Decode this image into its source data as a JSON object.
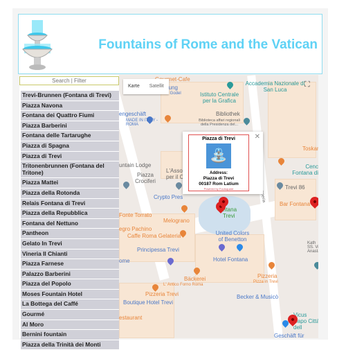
{
  "header": {
    "title": "Fountains of Rome and the Vatican"
  },
  "sidebar": {
    "search_placeholder": "Search | Filter",
    "items": [
      "Trevi-Brunnen (Fontana di Trevi)",
      "Piazza Navona",
      "Fontana dei Quattro Fiumi",
      "Piazza Barberini",
      "Fontana delle Tartarughe",
      "Piazza di Spagna",
      "Piazza di Trevi",
      "Tritonenbrunnen (Fontana del Tritone)",
      "Piazza Mattei",
      "Piazza della Rotonda",
      "Relais Fontana di Trevi",
      "Piazza della Repubblica",
      "Fontana del Nettuno",
      "Pantheon",
      "Gelato In Trevi",
      "Vineria Il Chianti",
      "Piazza Farnese",
      "Palazzo Barberini",
      "Piazza del Popolo",
      "Moses Fountain Hotel",
      "La Bottega del Caffé",
      "Gourmé",
      "Al Moro",
      "Bernini fountain",
      "Piazza della Trinità dei Monti"
    ]
  },
  "map": {
    "map_type": [
      "Karte",
      "Satellit"
    ],
    "fullscreen_icon": "fullscreen-icon",
    "labels": {
      "gourmet": "Gourmet-Cafe",
      "handlung": "handlung",
      "godel": "Libreria Godel",
      "istituto": "Istituto Centrale per la Grafica",
      "accademia": "Accademia Nazionale di San Luca",
      "geschaft": "engeschäft",
      "madein": "MADE IN ITALY -ROMA",
      "bibliothek": "Bibliothek",
      "biblioteca": "Biblioteca affari regionali della Presidenza del...",
      "lodge": "untain Lodge",
      "asso": "L'Asso per il C",
      "crociferi": "Piazza Crociferi",
      "crypto": "Crypto Pres",
      "stamperia": "Via della Stamperia",
      "toskan": "Toskan",
      "cen": "Cenc Fontana di",
      "trevi86": "Trevi 86",
      "barfontana": "Bar Fontana",
      "fonte": "Fonte Torrato",
      "melograno": "Melograno",
      "pachino": "egro Pachino",
      "caffe": "Caffe Roma Gelateria",
      "fontana_trevi": "ntana Trevi",
      "benetton": "United Colors of Benetton",
      "principessa": "Principessa Trevi",
      "hotelfontana": "Hotel Fontana",
      "rome": "ome",
      "backerei": "Bäckerei",
      "forno": "L' Antico Forno Roma",
      "pizzeria": "Pizzeria",
      "pizzaintrevi": "Pizza in Trevi",
      "pizzeriatrevi": "Pizzeria Trevi",
      "becker": "Becker & Musicò",
      "boutique": "Boutique Hotel Trevi",
      "restaurant": "estaurant",
      "vicus": "Vicus Capo Città dell",
      "geschaft2": "Geschäft für",
      "kath": "Kath SS. Vin Anasta"
    },
    "popup": {
      "title": "Piazza di Trevi",
      "address_label": "Address:",
      "address_line1": "Piazza di Trevi",
      "address_line2": "00187 Rom Latium",
      "powered": "Powered by Foursquare",
      "icon": "fountain-icon"
    }
  },
  "colors": {
    "title": "#5fd2f5",
    "list_bg": "#d0d0d8",
    "popup_border": "#e05050"
  }
}
